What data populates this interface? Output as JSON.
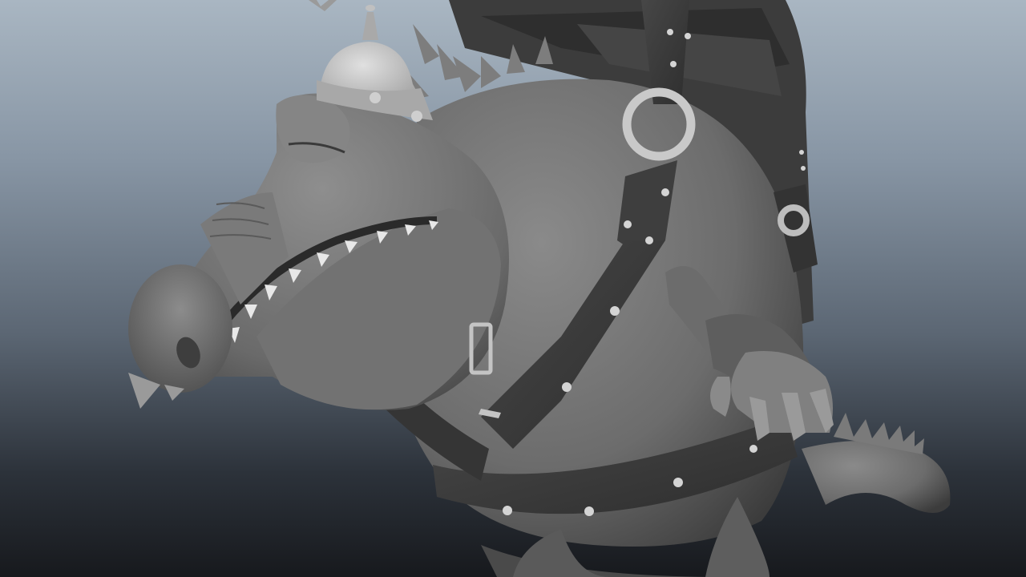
{
  "viewport": {
    "background_top": "#a9b6c2",
    "background_bottom": "#17191d"
  },
  "model": {
    "body_color": "#6e6e6e",
    "strap_color": "#3a3a3a",
    "rivet_color": "#d4d4d4",
    "helmet_color": "#bdbdbd",
    "ring_color": "#c9c9c9"
  }
}
